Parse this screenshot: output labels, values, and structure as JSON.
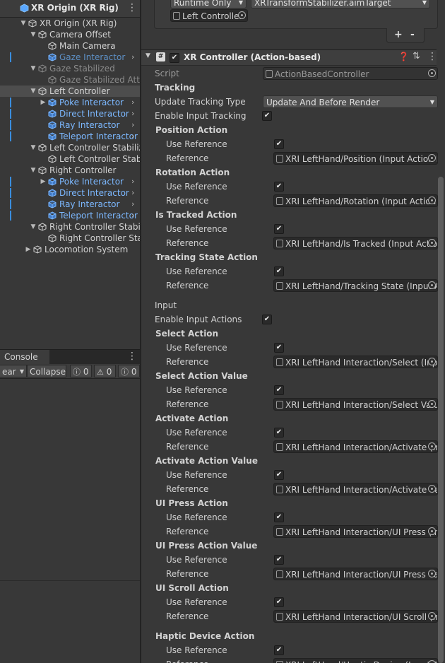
{
  "hierarchy": {
    "root_label": "XR Origin (XR Rig)",
    "menu_icon": "kebab-menu-icon",
    "rows": [
      {
        "label": "XR Origin (XR Rig)",
        "indent": 0,
        "arrow": "▼",
        "style": "normal"
      },
      {
        "label": "Camera Offset",
        "indent": 1,
        "arrow": "▼",
        "style": "normal"
      },
      {
        "label": "Main Camera",
        "indent": 2,
        "arrow": "",
        "style": "normal"
      },
      {
        "label": "Gaze Interactor",
        "indent": 2,
        "arrow": "",
        "style": "blue-dim"
      },
      {
        "label": "Gaze Stabilized",
        "indent": 1,
        "arrow": "▼",
        "style": "dim"
      },
      {
        "label": "Gaze Stabilized Attach",
        "indent": 2,
        "arrow": "",
        "style": "dim"
      },
      {
        "label": "Left Controller",
        "indent": 1,
        "arrow": "▼",
        "style": "selected"
      },
      {
        "label": "Poke Interactor",
        "indent": 2,
        "arrow": "▶",
        "style": "blue"
      },
      {
        "label": "Direct Interactor",
        "indent": 2,
        "arrow": "",
        "style": "blue"
      },
      {
        "label": "Ray Interactor",
        "indent": 2,
        "arrow": "",
        "style": "blue"
      },
      {
        "label": "Teleport Interactor",
        "indent": 2,
        "arrow": "",
        "style": "blue"
      },
      {
        "label": "Left Controller Stabilized",
        "indent": 1,
        "arrow": "▼",
        "style": "normal"
      },
      {
        "label": "Left Controller Stabilized Attach",
        "indent": 2,
        "arrow": "",
        "style": "normal"
      },
      {
        "label": "Right Controller",
        "indent": 1,
        "arrow": "▼",
        "style": "normal"
      },
      {
        "label": "Poke Interactor",
        "indent": 2,
        "arrow": "▶",
        "style": "blue"
      },
      {
        "label": "Direct Interactor",
        "indent": 2,
        "arrow": "",
        "style": "blue"
      },
      {
        "label": "Ray Interactor",
        "indent": 2,
        "arrow": "",
        "style": "blue"
      },
      {
        "label": "Teleport Interactor",
        "indent": 2,
        "arrow": "",
        "style": "blue"
      },
      {
        "label": "Right Controller Stabilized",
        "indent": 1,
        "arrow": "▼",
        "style": "normal"
      },
      {
        "label": "Right Controller Stabilized Attach",
        "indent": 2,
        "arrow": "",
        "style": "normal"
      },
      {
        "label": "Locomotion System",
        "indent": 0.5,
        "arrow": "▶",
        "style": "normal"
      }
    ]
  },
  "console": {
    "tab_label": "Console",
    "clear_label": "ear",
    "collapse_label": "Collapse",
    "info_count": "0",
    "warn_count": "0",
    "error_count": "0"
  },
  "top_component": {
    "runtime_dropdown": "Runtime Only",
    "method_dropdown": "XRTransformStabilizer.aimTarget",
    "object_field": "Left Controller",
    "plus_label": "+",
    "minus_label": "-"
  },
  "component": {
    "title": "XR Controller (Action-based)",
    "enabled": true,
    "script_label": "Script",
    "script_value": "ActionBasedController",
    "tracking_header": "Tracking",
    "update_tracking_type_label": "Update Tracking Type",
    "update_tracking_type_value": "Update And Before Render",
    "enable_input_tracking_label": "Enable Input Tracking",
    "input_header": "Input",
    "enable_input_actions_label": "Enable Input Actions",
    "use_reference_label": "Use Reference",
    "reference_label": "Reference",
    "tracking_actions": [
      {
        "name": "Position Action",
        "reference": "XRI LeftHand/Position (Input Action Reference)"
      },
      {
        "name": "Rotation Action",
        "reference": "XRI LeftHand/Rotation (Input Action Reference)"
      },
      {
        "name": "Is Tracked Action",
        "reference": "XRI LeftHand/Is Tracked (Input Action Reference)"
      },
      {
        "name": "Tracking State Action",
        "reference": "XRI LeftHand/Tracking State (Input Action Reference)"
      }
    ],
    "input_actions": [
      {
        "name": "Select Action",
        "reference": "XRI LeftHand Interaction/Select (Input Action Reference)"
      },
      {
        "name": "Select Action Value",
        "reference": "XRI LeftHand Interaction/Select Value (Input Action Reference)"
      },
      {
        "name": "Activate Action",
        "reference": "XRI LeftHand Interaction/Activate (Input Action Reference)"
      },
      {
        "name": "Activate Action Value",
        "reference": "XRI LeftHand Interaction/Activate Value (Input Action Reference)"
      },
      {
        "name": "UI Press Action",
        "reference": "XRI LeftHand Interaction/UI Press (Input Action Reference)"
      },
      {
        "name": "UI Press Action Value",
        "reference": "XRI LeftHand Interaction/UI Press Value (Input Action Reference)"
      },
      {
        "name": "UI Scroll Action",
        "reference": "XRI LeftHand Interaction/UI Scroll (Input Action Reference)"
      }
    ],
    "haptic_action": {
      "name": "Haptic Device Action",
      "reference": "XRI LeftHand/Haptic Device (Input Action Reference)"
    }
  }
}
